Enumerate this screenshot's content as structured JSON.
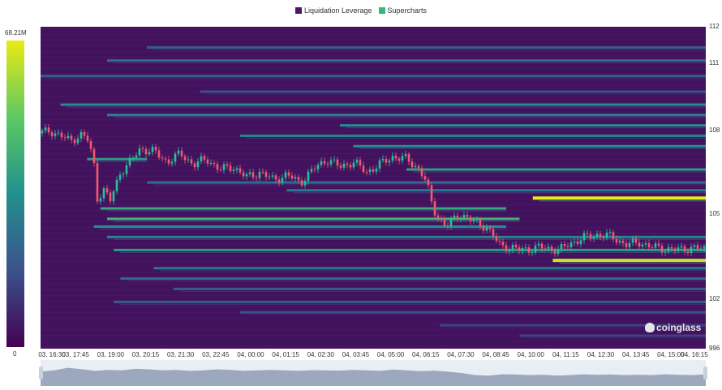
{
  "legend": {
    "items": [
      {
        "label": "Liquidation Leverage",
        "color": "#4a1767"
      },
      {
        "label": "Supercharts",
        "color": "#35b779"
      }
    ]
  },
  "colorbar": {
    "max_label": "68.21M",
    "min_label": "0"
  },
  "watermark": "coinglass",
  "chart_data": {
    "type": "heatmap",
    "title": "",
    "legend_position": "top-center",
    "x_ticks": [
      "03, 16:30",
      "03, 17:45",
      "03, 19:00",
      "03, 20:15",
      "03, 21:30",
      "03, 22:45",
      "04, 00:00",
      "04, 01:15",
      "04, 02:30",
      "04, 03:45",
      "04, 05:00",
      "04, 06:15",
      "04, 07:30",
      "04, 08:45",
      "04, 10:00",
      "04, 11:15",
      "04, 12:30",
      "04, 13:45",
      "04, 15:00",
      "04, 16:15"
    ],
    "y_ticks": [
      "112",
      "111",
      "108",
      "105",
      "102",
      "996"
    ],
    "y_tick_values": [
      112.0,
      110.6,
      108.0,
      104.8,
      101.5,
      99.6
    ],
    "ylim": [
      99.6,
      112.0
    ],
    "colorscale": {
      "min": 0,
      "max": 68.21,
      "unit": "M",
      "colors": [
        "#440154",
        "#3b528b",
        "#21908d",
        "#5dc963",
        "#e9ea14"
      ]
    },
    "bands": [
      {
        "price": 111.2,
        "t_start": 0.16,
        "t_end": 1.0,
        "intensity": 0.3
      },
      {
        "price": 110.7,
        "t_start": 0.1,
        "t_end": 1.0,
        "intensity": 0.35
      },
      {
        "price": 110.1,
        "t_start": 0.0,
        "t_end": 1.0,
        "intensity": 0.3
      },
      {
        "price": 109.5,
        "t_start": 0.24,
        "t_end": 1.0,
        "intensity": 0.25
      },
      {
        "price": 109.0,
        "t_start": 0.03,
        "t_end": 1.0,
        "intensity": 0.5
      },
      {
        "price": 108.6,
        "t_start": 0.1,
        "t_end": 1.0,
        "intensity": 0.45
      },
      {
        "price": 108.2,
        "t_start": 0.45,
        "t_end": 1.0,
        "intensity": 0.5
      },
      {
        "price": 107.8,
        "t_start": 0.3,
        "t_end": 1.0,
        "intensity": 0.45
      },
      {
        "price": 107.4,
        "t_start": 0.47,
        "t_end": 1.0,
        "intensity": 0.5
      },
      {
        "price": 106.9,
        "t_start": 0.07,
        "t_end": 0.16,
        "intensity": 0.55
      },
      {
        "price": 106.5,
        "t_start": 0.55,
        "t_end": 1.0,
        "intensity": 0.55
      },
      {
        "price": 106.0,
        "t_start": 0.16,
        "t_end": 1.0,
        "intensity": 0.35
      },
      {
        "price": 105.7,
        "t_start": 0.37,
        "t_end": 1.0,
        "intensity": 0.4
      },
      {
        "price": 105.4,
        "t_start": 0.74,
        "t_end": 1.0,
        "intensity": 1.0
      },
      {
        "price": 105.0,
        "t_start": 0.09,
        "t_end": 0.7,
        "intensity": 0.6
      },
      {
        "price": 104.6,
        "t_start": 0.1,
        "t_end": 0.72,
        "intensity": 0.65
      },
      {
        "price": 104.3,
        "t_start": 0.08,
        "t_end": 0.7,
        "intensity": 0.5
      },
      {
        "price": 103.9,
        "t_start": 0.1,
        "t_end": 1.0,
        "intensity": 0.45
      },
      {
        "price": 103.4,
        "t_start": 0.11,
        "t_end": 1.0,
        "intensity": 0.55
      },
      {
        "price": 103.0,
        "t_start": 0.77,
        "t_end": 1.0,
        "intensity": 0.95
      },
      {
        "price": 102.7,
        "t_start": 0.17,
        "t_end": 1.0,
        "intensity": 0.4
      },
      {
        "price": 102.3,
        "t_start": 0.12,
        "t_end": 1.0,
        "intensity": 0.35
      },
      {
        "price": 101.9,
        "t_start": 0.2,
        "t_end": 1.0,
        "intensity": 0.3
      },
      {
        "price": 101.4,
        "t_start": 0.11,
        "t_end": 1.0,
        "intensity": 0.3
      },
      {
        "price": 101.0,
        "t_start": 0.3,
        "t_end": 1.0,
        "intensity": 0.25
      },
      {
        "price": 100.5,
        "t_start": 0.6,
        "t_end": 1.0,
        "intensity": 0.2
      },
      {
        "price": 100.1,
        "t_start": 0.72,
        "t_end": 1.0,
        "intensity": 0.2
      }
    ],
    "price_path": [
      {
        "t": 0.0,
        "p": 107.9
      },
      {
        "t": 0.015,
        "p": 108.0
      },
      {
        "t": 0.03,
        "p": 107.8
      },
      {
        "t": 0.045,
        "p": 107.6
      },
      {
        "t": 0.06,
        "p": 107.85
      },
      {
        "t": 0.07,
        "p": 107.7
      },
      {
        "t": 0.08,
        "p": 106.8
      },
      {
        "t": 0.085,
        "p": 105.4
      },
      {
        "t": 0.095,
        "p": 105.7
      },
      {
        "t": 0.105,
        "p": 105.3
      },
      {
        "t": 0.12,
        "p": 106.4
      },
      {
        "t": 0.135,
        "p": 106.8
      },
      {
        "t": 0.15,
        "p": 107.3
      },
      {
        "t": 0.17,
        "p": 107.2
      },
      {
        "t": 0.19,
        "p": 106.8
      },
      {
        "t": 0.21,
        "p": 107.1
      },
      {
        "t": 0.23,
        "p": 106.7
      },
      {
        "t": 0.25,
        "p": 106.9
      },
      {
        "t": 0.27,
        "p": 106.5
      },
      {
        "t": 0.29,
        "p": 106.6
      },
      {
        "t": 0.31,
        "p": 106.2
      },
      {
        "t": 0.33,
        "p": 106.4
      },
      {
        "t": 0.35,
        "p": 106.1
      },
      {
        "t": 0.37,
        "p": 106.3
      },
      {
        "t": 0.39,
        "p": 106.0
      },
      {
        "t": 0.41,
        "p": 106.5
      },
      {
        "t": 0.43,
        "p": 106.9
      },
      {
        "t": 0.45,
        "p": 106.6
      },
      {
        "t": 0.47,
        "p": 106.8
      },
      {
        "t": 0.49,
        "p": 106.4
      },
      {
        "t": 0.51,
        "p": 106.7
      },
      {
        "t": 0.53,
        "p": 107.0
      },
      {
        "t": 0.55,
        "p": 106.9
      },
      {
        "t": 0.57,
        "p": 106.5
      },
      {
        "t": 0.58,
        "p": 106.0
      },
      {
        "t": 0.59,
        "p": 105.0
      },
      {
        "t": 0.6,
        "p": 104.6
      },
      {
        "t": 0.61,
        "p": 104.3
      },
      {
        "t": 0.63,
        "p": 104.8
      },
      {
        "t": 0.65,
        "p": 104.5
      },
      {
        "t": 0.67,
        "p": 104.3
      },
      {
        "t": 0.69,
        "p": 103.6
      },
      {
        "t": 0.72,
        "p": 103.4
      },
      {
        "t": 0.75,
        "p": 103.5
      },
      {
        "t": 0.78,
        "p": 103.4
      },
      {
        "t": 0.8,
        "p": 103.7
      },
      {
        "t": 0.82,
        "p": 103.9
      },
      {
        "t": 0.84,
        "p": 104.0
      },
      {
        "t": 0.86,
        "p": 103.9
      },
      {
        "t": 0.88,
        "p": 103.6
      },
      {
        "t": 0.9,
        "p": 103.7
      },
      {
        "t": 0.92,
        "p": 103.5
      },
      {
        "t": 0.94,
        "p": 103.45
      },
      {
        "t": 0.96,
        "p": 103.4
      },
      {
        "t": 0.98,
        "p": 103.5
      },
      {
        "t": 1.0,
        "p": 103.4
      }
    ],
    "navigator_volume": [
      0.55,
      0.6,
      0.7,
      0.65,
      0.58,
      0.62,
      0.6,
      0.66,
      0.64,
      0.6,
      0.62,
      0.58,
      0.6,
      0.64,
      0.62,
      0.58,
      0.6,
      0.62,
      0.6,
      0.58,
      0.61,
      0.6,
      0.59,
      0.62,
      0.6,
      0.58,
      0.63,
      0.6,
      0.57,
      0.59,
      0.55,
      0.5,
      0.42,
      0.4,
      0.45,
      0.44,
      0.42,
      0.43,
      0.4,
      0.42,
      0.45,
      0.43,
      0.44,
      0.42,
      0.43,
      0.42,
      0.45,
      0.43,
      0.42,
      0.44
    ]
  }
}
